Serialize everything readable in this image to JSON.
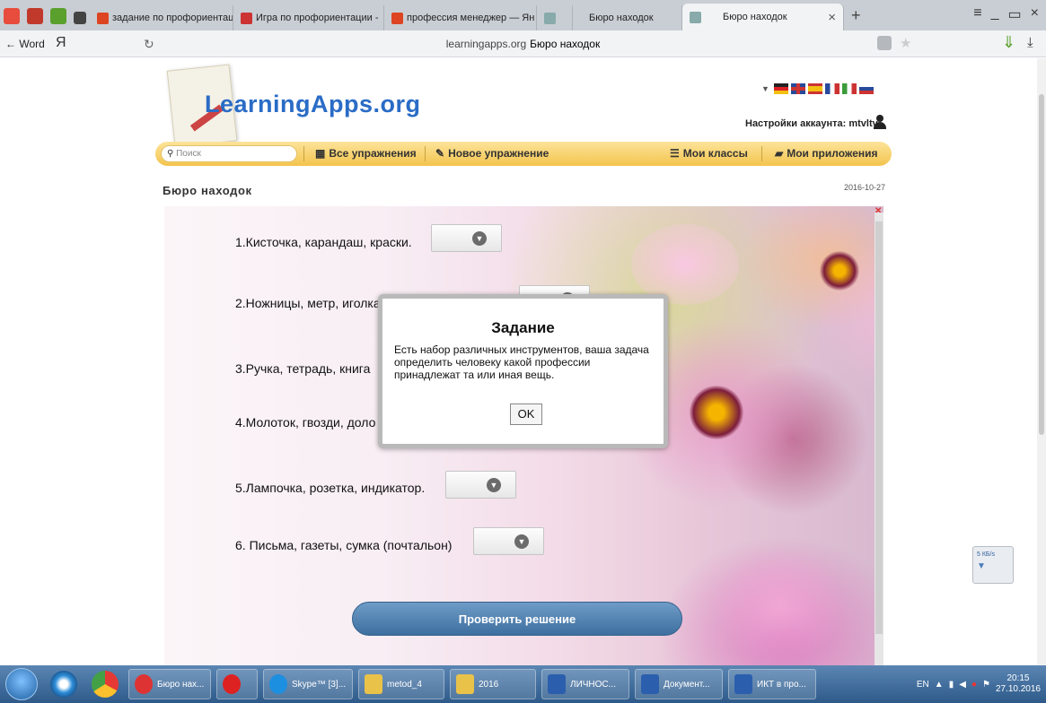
{
  "browser": {
    "tabs": [
      {
        "label": "задание по профориентац",
        "fav": "#d42"
      },
      {
        "label": "Игра по профориентации -",
        "fav": "#c33"
      },
      {
        "label": "профессия менеджер — Ян",
        "fav": "#d42"
      },
      {
        "label": "",
        "fav": "#8aa"
      },
      {
        "label": "Бюро находок",
        "fav": ""
      },
      {
        "label": "Бюро находок",
        "fav": "#8aa",
        "active": true
      }
    ],
    "close_glyph": "×",
    "new_tab_glyph": "+",
    "window_controls": [
      "≡",
      "_",
      "▭",
      "×"
    ],
    "back_label": "← Word",
    "yandex_glyph": "Я",
    "url_host": "learningapps.org",
    "url_title": "Бюро находок"
  },
  "site": {
    "logo": "LearningApps.org",
    "account_label": "Настройки аккаунта: mtvltv",
    "search_placeholder": "Поиск",
    "nav": {
      "all": "Все упражнения",
      "new": "Новое упражнение",
      "classes": "Мои классы",
      "apps": "Мои приложения"
    },
    "page_title": "Бюро находок",
    "date": "2016-10-27",
    "flag_colors": [
      [
        "#c33",
        "#f0c020"
      ],
      [
        "#274a9a",
        "#c33"
      ],
      [
        "#c33",
        "#f3c012"
      ],
      [
        "#3a9c3a",
        "#c33"
      ],
      [
        "#3a9c3a",
        "#c33"
      ],
      [
        "#fff",
        "#c33"
      ]
    ]
  },
  "app": {
    "questions": [
      "1.Кисточка, карандаш, краски.",
      "2.Ножницы, метр, иголка с ниткой, выкройка.",
      "3.Ручка, тетрадь, книга",
      "4.Молоток, гвозди, доло",
      "5.Лампочка, розетка, индикатор.",
      "6. Письма, газеты, сумка (почтальон)"
    ],
    "check_button": "Проверить решение",
    "dialog": {
      "title": "Задание",
      "body": "Есть набор различных инструментов, ваша задача определить человеку какой профессии принадлежат та или иная вещь.",
      "ok": "OK"
    }
  },
  "widget": {
    "speed": "5 КБ/s"
  },
  "taskbar": {
    "items": [
      {
        "label": "Бюро нах...",
        "color": "#d33"
      },
      {
        "label": "",
        "color": "#d22"
      },
      {
        "label": "Skype™ [3]...",
        "color": "#1d8fe0"
      },
      {
        "label": "metod_4",
        "color": "#e9c24a"
      },
      {
        "label": "2016",
        "color": "#e9c24a"
      },
      {
        "label": "ЛИЧНОС...",
        "color": "#2b5fae"
      },
      {
        "label": "Документ...",
        "color": "#2b5fae"
      },
      {
        "label": "ИКТ в про...",
        "color": "#2b5fae"
      }
    ],
    "lang": "EN",
    "time": "20:15",
    "date": "27.10.2016"
  }
}
